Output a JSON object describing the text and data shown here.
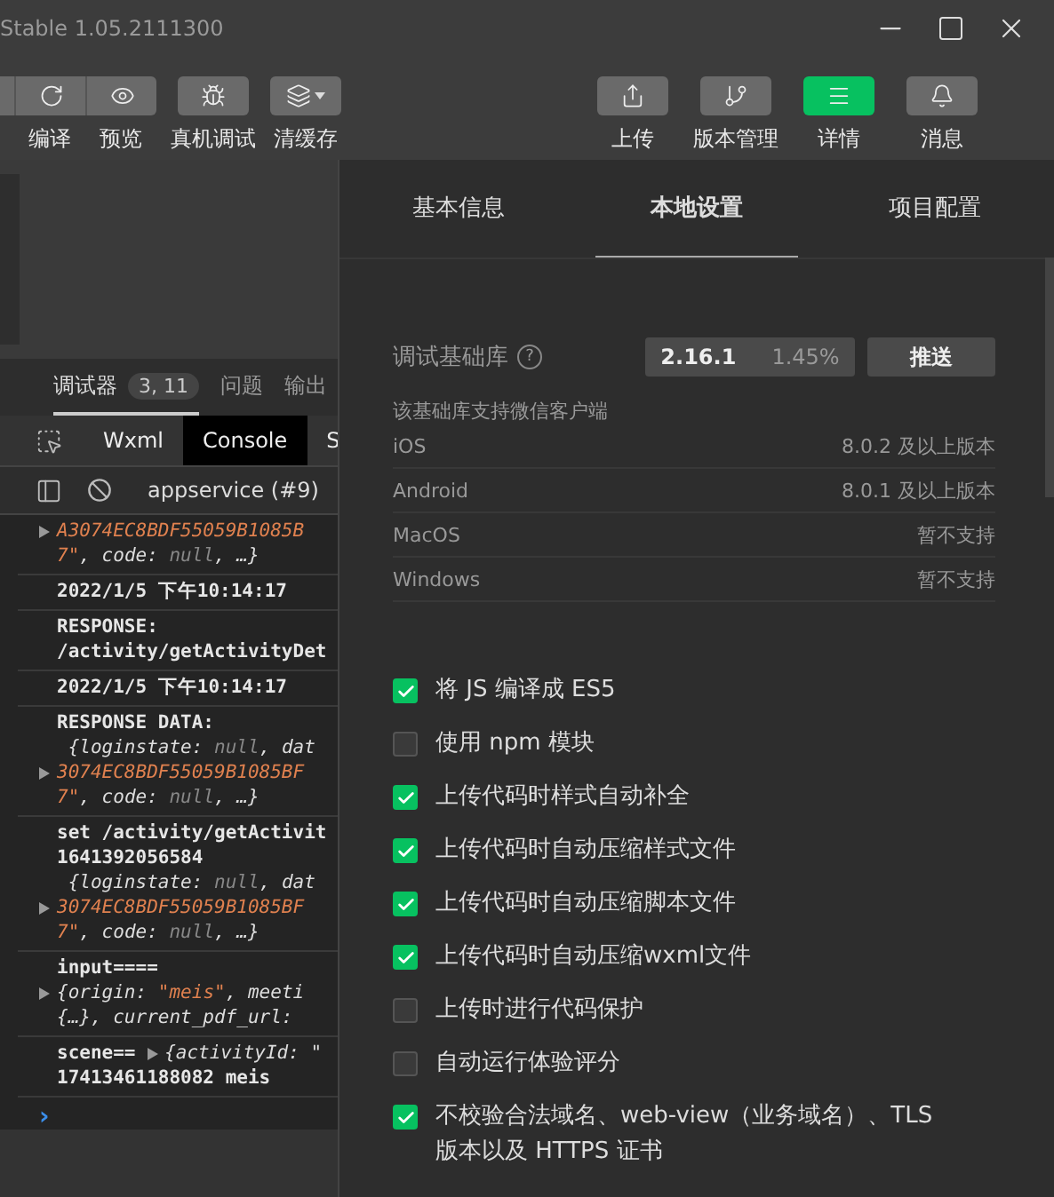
{
  "window": {
    "title": "Stable 1.05.2111300"
  },
  "toolbar": {
    "left_groups": [
      [
        {
          "label": "编译"
        },
        {
          "label": "预览"
        }
      ],
      [
        {
          "label": "真机调试"
        }
      ],
      [
        {
          "label": "清缓存"
        }
      ]
    ],
    "right": [
      {
        "label": "上传",
        "selected": false
      },
      {
        "label": "版本管理",
        "selected": false
      },
      {
        "label": "详情",
        "selected": true
      },
      {
        "label": "消息",
        "selected": false
      }
    ]
  },
  "debugger": {
    "tabs": [
      {
        "label": "调试器",
        "selected": true,
        "badge": "3, 11"
      },
      {
        "label": "问题",
        "selected": false
      },
      {
        "label": "输出",
        "selected": false
      }
    ],
    "devtools_tabs": [
      {
        "label": "Wxml",
        "selected": false
      },
      {
        "label": "Console",
        "selected": true
      },
      {
        "label": "S",
        "selected": false
      }
    ],
    "context": "appservice (#9)",
    "logs": [
      {
        "lines": [
          {
            "arrow": true,
            "parts": [
              {
                "t": "A3074EC8BDF55059B1085B",
                "kind": "str"
              }
            ]
          },
          {
            "arrow": false,
            "parts": [
              {
                "t": "7\"",
                "kind": "str"
              },
              {
                "t": ", code: ",
                "kind": "key"
              },
              {
                "t": "null",
                "kind": "null"
              },
              {
                "t": ", …}",
                "kind": "key"
              }
            ]
          }
        ]
      },
      {
        "lines": [
          {
            "arrow": false,
            "parts": [
              {
                "t": "2022/1/5 下午10:14:17",
                "kind": "plain"
              }
            ]
          }
        ]
      },
      {
        "lines": [
          {
            "arrow": false,
            "parts": [
              {
                "t": "RESPONSE:",
                "kind": "plain"
              }
            ]
          },
          {
            "arrow": false,
            "parts": [
              {
                "t": "/activity/getActivityDet",
                "kind": "plain"
              }
            ]
          }
        ]
      },
      {
        "lines": [
          {
            "arrow": false,
            "parts": [
              {
                "t": "2022/1/5 下午10:14:17",
                "kind": "plain"
              }
            ]
          }
        ]
      },
      {
        "lines": [
          {
            "arrow": false,
            "parts": [
              {
                "t": "RESPONSE DATA:",
                "kind": "plain"
              }
            ]
          },
          {
            "arrow": false,
            "parts": [
              {
                "t": " {loginstate: ",
                "kind": "key"
              },
              {
                "t": "null",
                "kind": "null"
              },
              {
                "t": ", dat",
                "kind": "key"
              }
            ]
          },
          {
            "arrow": true,
            "parts": [
              {
                "t": "3074EC8BDF55059B1085BF",
                "kind": "str"
              }
            ]
          },
          {
            "arrow": false,
            "parts": [
              {
                "t": "7\"",
                "kind": "str"
              },
              {
                "t": ", code: ",
                "kind": "key"
              },
              {
                "t": "null",
                "kind": "null"
              },
              {
                "t": ", …}",
                "kind": "key"
              }
            ]
          }
        ]
      },
      {
        "lines": [
          {
            "arrow": false,
            "parts": [
              {
                "t": "set /activity/getActivit",
                "kind": "plain"
              }
            ]
          },
          {
            "arrow": false,
            "parts": [
              {
                "t": "1641392056584",
                "kind": "plain"
              }
            ]
          },
          {
            "arrow": false,
            "parts": [
              {
                "t": " {loginstate: ",
                "kind": "key"
              },
              {
                "t": "null",
                "kind": "null"
              },
              {
                "t": ", dat",
                "kind": "key"
              }
            ]
          },
          {
            "arrow": true,
            "parts": [
              {
                "t": "3074EC8BDF55059B1085BF",
                "kind": "str"
              }
            ]
          },
          {
            "arrow": false,
            "parts": [
              {
                "t": "7\"",
                "kind": "str"
              },
              {
                "t": ", code: ",
                "kind": "key"
              },
              {
                "t": "null",
                "kind": "null"
              },
              {
                "t": ", …}",
                "kind": "key"
              }
            ]
          }
        ]
      },
      {
        "lines": [
          {
            "arrow": false,
            "parts": [
              {
                "t": "input====",
                "kind": "plain"
              }
            ]
          },
          {
            "arrow": true,
            "parts": [
              {
                "t": "{origin: ",
                "kind": "key"
              },
              {
                "t": "\"meis\"",
                "kind": "str"
              },
              {
                "t": ", meeti",
                "kind": "key"
              }
            ]
          },
          {
            "arrow": false,
            "parts": [
              {
                "t": "{…}, current_pdf_url:",
                "kind": "key"
              }
            ]
          }
        ]
      },
      {
        "lines": [
          {
            "arrow": false,
            "parts": [
              {
                "t": "scene== ",
                "kind": "plain"
              },
              {
                "kind": "arrow"
              },
              {
                "t": "{activityId: \"",
                "kind": "key"
              }
            ]
          },
          {
            "arrow": false,
            "parts": [
              {
                "t": "17413461188082 meis",
                "kind": "plain"
              }
            ]
          }
        ]
      }
    ],
    "prompt": "›"
  },
  "settings": {
    "tabs": [
      {
        "label": "基本信息",
        "selected": false
      },
      {
        "label": "本地设置",
        "selected": true
      },
      {
        "label": "项目配置",
        "selected": false
      }
    ],
    "library": {
      "label": "调试基础库",
      "help": "?",
      "version": "2.16.1",
      "share": "1.45%",
      "button": "推送"
    },
    "support_title": "该基础库支持微信客户端",
    "support": [
      {
        "platform": "iOS",
        "value": "8.0.2 及以上版本"
      },
      {
        "platform": "Android",
        "value": "8.0.1 及以上版本"
      },
      {
        "platform": "MacOS",
        "value": "暂不支持"
      },
      {
        "platform": "Windows",
        "value": "暂不支持"
      }
    ],
    "options": [
      {
        "label": "将 JS 编译成 ES5",
        "checked": true
      },
      {
        "label": "使用 npm 模块",
        "checked": false
      },
      {
        "label": "上传代码时样式自动补全",
        "checked": true
      },
      {
        "label": "上传代码时自动压缩样式文件",
        "checked": true
      },
      {
        "label": "上传代码时自动压缩脚本文件",
        "checked": true
      },
      {
        "label": "上传代码时自动压缩wxml文件",
        "checked": true
      },
      {
        "label": "上传时进行代码保护",
        "checked": false
      },
      {
        "label": "自动运行体验评分",
        "checked": false
      },
      {
        "label": "不校验合法域名、web-view（业务域名）、TLS 版本以及 HTTPS 证书",
        "checked": true
      }
    ]
  }
}
